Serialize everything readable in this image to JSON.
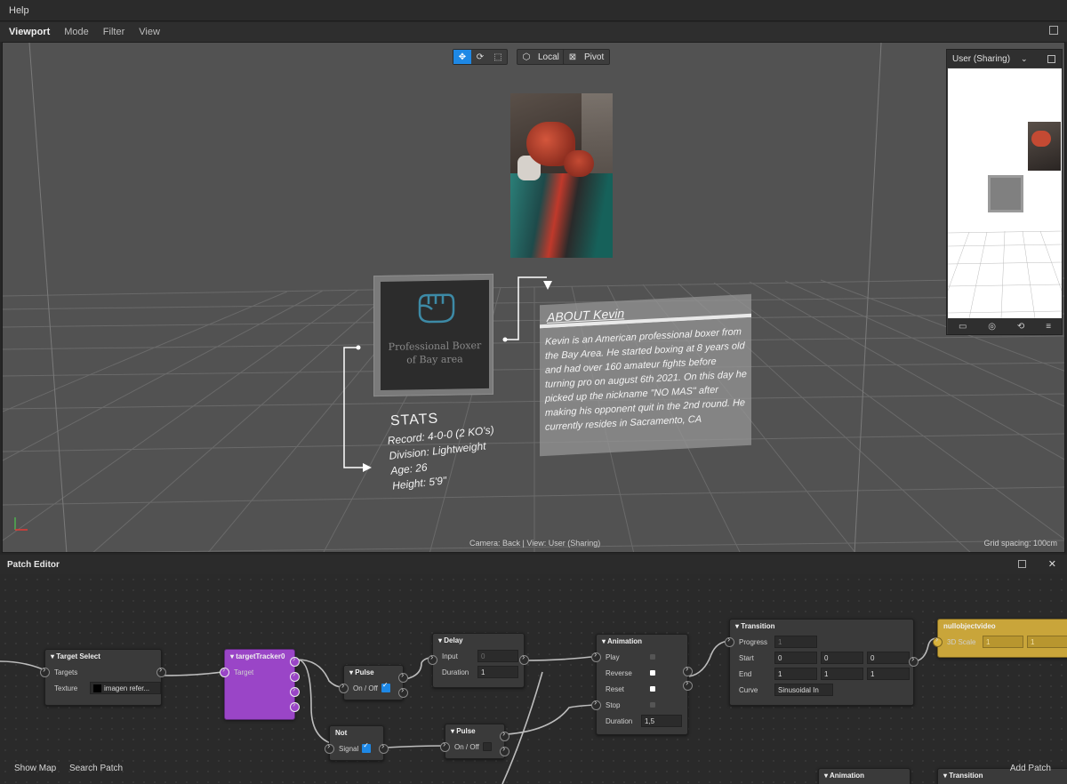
{
  "menubar": {
    "help": "Help"
  },
  "viewport_tabs": {
    "viewport": "Viewport",
    "mode": "Mode",
    "filter": "Filter",
    "view": "View"
  },
  "toolbar": {
    "local": "Local",
    "pivot": "Pivot"
  },
  "scene": {
    "card_title_line1": "Professional Boxer",
    "card_title_line2": "of Bay area",
    "stats_title": "STATS",
    "stats_record": "Record: 4-0-0 (2 KO's)",
    "stats_division": "Division: Lightweight",
    "stats_age": "Age: 26",
    "stats_height": "Height: 5'9\"",
    "about_title": "ABOUT Kevin",
    "about_text": "Kevin is an American professional boxer from the Bay Area. He started boxing at 8 years old and had over 160 amateur fights before turning pro on august 6th 2021. On this day he picked up the nickname \"NO MAS\" after making his opponent quit in the 2nd round. He currently resides in Sacramento, CA"
  },
  "preview": {
    "camera": "User (Sharing)"
  },
  "viewport_status": {
    "camera": "Camera: Back | View: User (Sharing)",
    "grid": "Grid spacing: 100cm"
  },
  "patch_editor": {
    "title": "Patch Editor",
    "footer": {
      "show_map": "Show Map",
      "search_patch": "Search Patch",
      "add_patch": "Add Patch"
    },
    "nodes": {
      "target_select": {
        "title": "Target Select",
        "targets": "Targets",
        "texture": "Texture",
        "texture_value": "imagen refer..."
      },
      "target_tracker": {
        "title": "targetTracker0",
        "target": "Target"
      },
      "pulse1": {
        "title": "Pulse",
        "onoff": "On / Off"
      },
      "not": {
        "title": "Not",
        "signal": "Signal"
      },
      "delay": {
        "title": "Delay",
        "input": "Input",
        "input_value": "0",
        "duration": "Duration",
        "duration_value": "1"
      },
      "pulse2": {
        "title": "Pulse",
        "onoff": "On / Off"
      },
      "animation": {
        "title": "Animation",
        "play": "Play",
        "reverse": "Reverse",
        "reset": "Reset",
        "stop": "Stop",
        "duration": "Duration",
        "duration_value": "1,5"
      },
      "transition": {
        "title": "Transition",
        "progress": "Progress",
        "progress_value": "1",
        "start": "Start",
        "end": "End",
        "curve": "Curve",
        "curve_value": "Sinusoidal In",
        "start_values": [
          "0",
          "0",
          "0"
        ],
        "end_values": [
          "1",
          "1",
          "1"
        ]
      },
      "nullobject": {
        "title": "nullobjectvideo",
        "scale": "3D Scale",
        "scale_values": [
          "1",
          "1"
        ]
      },
      "animation2": {
        "title": "Animation"
      },
      "transition2": {
        "title": "Transition"
      }
    }
  },
  "colors": {
    "accent": "#1e88e5",
    "tracker": "#9a45c7",
    "nullobject": "#c9a53a"
  }
}
